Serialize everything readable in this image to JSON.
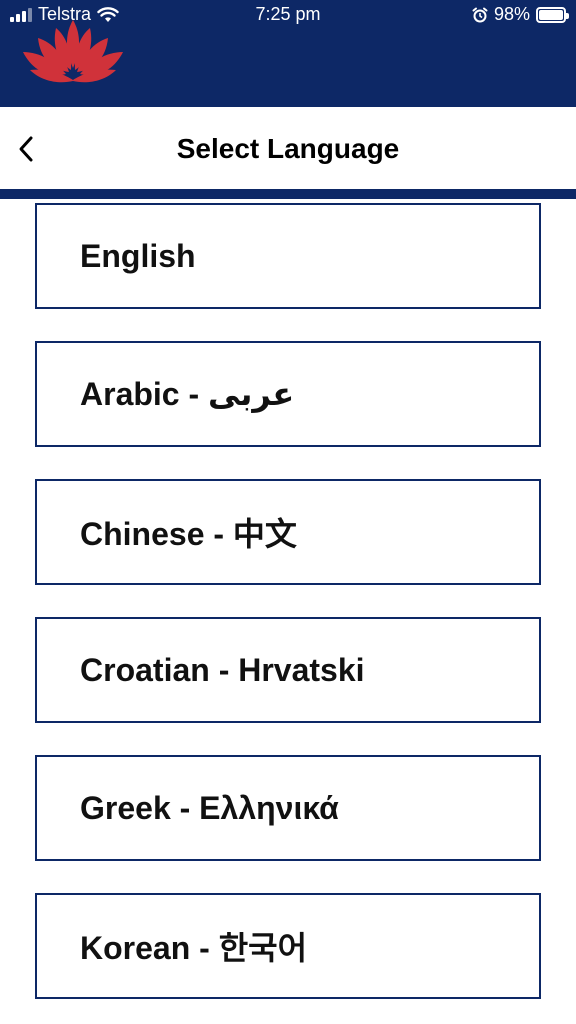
{
  "status_bar": {
    "carrier": "Telstra",
    "time": "7:25 pm",
    "battery": "98%",
    "battery_level": 0.98
  },
  "header": {
    "logo_icon": "lotus-logo-icon",
    "brand_color": "#0d2866",
    "logo_color": "#d0323a"
  },
  "title_bar": {
    "title": "Select Language",
    "back_icon": "chevron-left-icon"
  },
  "languages": [
    {
      "label": "English"
    },
    {
      "label": "Arabic - عربى"
    },
    {
      "label": "Chinese - 中文"
    },
    {
      "label": "Croatian - Hrvatski"
    },
    {
      "label": "Greek - Ελληνικά"
    },
    {
      "label": "Korean - 한국어"
    }
  ]
}
